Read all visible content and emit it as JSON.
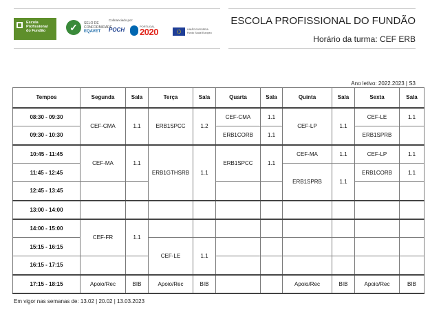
{
  "header": {
    "school_logo_text": "Escola\nProfissional\ndo Fundão",
    "school_logo_tagline": "EDUCAÇÃO, QUALIDADE E CIDADANIA",
    "eqavet_text": "SELO DE\nCONFORMIDADE",
    "eqavet_brand": "EQAVET",
    "cofinanced_label": "Cofinanciado por:",
    "poch_label": "POCH",
    "portugal2020_small": "PORTUGAL",
    "portugal2020_num": "2020",
    "eu_text": "UNIÃO EUROPEIA\nFundo Social Europeu",
    "school_name": "ESCOLA PROFISSIONAL DO FUNDÃO",
    "class_schedule": "Horário da turma:  CEF ERB"
  },
  "year_line": "Ano letivo: 2022.2023 | S3",
  "table": {
    "headers": [
      "Tempos",
      "Segunda",
      "Sala",
      "Terça",
      "Sala",
      "Quarta",
      "Sala",
      "Quinta",
      "Sala",
      "Sexta",
      "Sala"
    ],
    "times": [
      "08:30 - 09:30",
      "09:30 - 10:30",
      "10:45 - 11:45",
      "11:45 - 12:45",
      "12:45 - 13:45",
      "13:00 - 14:00",
      "14:00 - 15:00",
      "15:15 - 16:15",
      "16:15 - 17:15",
      "17:15 - 18:15"
    ],
    "monday": {
      "b1_subject": "CEF-CMA",
      "b1_room": "1.1",
      "b2_subject": "CEF-MA",
      "b2_room": "1.1",
      "b3_subject": "CEF-FR",
      "b3_room": "1.1",
      "last_subject": "Apoio/Rec",
      "last_room": "BIB"
    },
    "tuesday": {
      "b1_subject": "ERB1SPCC",
      "b1_room": "1.2",
      "b2_subject": "ERB1GTHSRB",
      "b2_room": "1.1",
      "b3_subject": "CEF-LE",
      "b3_room": "1.1",
      "last_subject": "Apoio/Rec",
      "last_room": "BIB"
    },
    "wednesday": {
      "r1_subject": "CEF-CMA",
      "r1_room": "1.1",
      "r2_subject": "ERB1CORB",
      "r2_room": "1.1",
      "b2_subject": "ERB1SPCC",
      "b2_room": "1.1"
    },
    "thursday": {
      "b1_subject": "CEF-LP",
      "b1_room": "1.1",
      "r3_subject": "CEF-MA",
      "r3_room": "1.1",
      "b2_subject": "ERB1SPRB",
      "b2_room": "1.1",
      "last_subject": "Apoio/Rec",
      "last_room": "BIB"
    },
    "friday": {
      "r1_subject": "CEF-LE",
      "r1_room": "1.1",
      "r2_subject": "ERB1SPRB",
      "r2_room": "",
      "r3_subject": "CEF-LP",
      "r3_room": "1.1",
      "r4_subject": "ERB1CORB",
      "r4_room": "1.1",
      "last_subject": "Apoio/Rec",
      "last_room": "BIB"
    }
  },
  "footer": "Em vigor nas semanas de: 13.02 | 20.02 | 13.03.2023"
}
